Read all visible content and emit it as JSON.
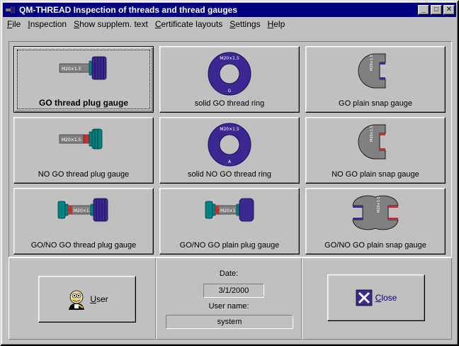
{
  "window": {
    "title": "QM-THREAD Inspection of threads and thread gauges",
    "controls": {
      "minimize": "_",
      "maximize": "□",
      "close": "✕"
    }
  },
  "menu": [
    {
      "key": "F",
      "rest": "ile"
    },
    {
      "key": "I",
      "rest": "nspection"
    },
    {
      "key": "S",
      "rest": "how supplem. text"
    },
    {
      "key": "C",
      "rest": "ertificate layouts"
    },
    {
      "key": "S",
      "rest": "ettings"
    },
    {
      "key": "H",
      "rest": "elp"
    }
  ],
  "gauges": [
    {
      "label": "GO thread plug gauge",
      "icon": "thread-plug-go-icon",
      "marking": "M20×1.5"
    },
    {
      "label": "solid GO thread ring",
      "icon": "thread-ring-go-icon",
      "marking": "M20×1.5",
      "letter": "G"
    },
    {
      "label": "GO plain snap gauge",
      "icon": "snap-gauge-go-icon",
      "marking": "M20×1.5"
    },
    {
      "label": "NO GO thread plug gauge",
      "icon": "thread-plug-nogo-icon",
      "marking": "M20×1.5"
    },
    {
      "label": "solid NO GO thread ring",
      "icon": "thread-ring-nogo-icon",
      "marking": "M20×1.5",
      "letter": "A"
    },
    {
      "label": "NO GO plain snap gauge",
      "icon": "snap-gauge-nogo-icon",
      "marking": "M20×1.5"
    },
    {
      "label": "GO/NO GO thread plug gauge",
      "icon": "thread-plug-gonogo-icon",
      "marking": "M20×1.5"
    },
    {
      "label": "GO/NO GO plain plug gauge",
      "icon": "plain-plug-gonogo-icon",
      "marking": "M20×1.5"
    },
    {
      "label": "GO/NO GO plain snap gauge",
      "icon": "snap-gauge-gonogo-icon",
      "marking": "M20×1.5"
    }
  ],
  "user_button": {
    "key": "U",
    "rest": "ser"
  },
  "close_button": {
    "key": "C",
    "rest": "lose"
  },
  "info": {
    "date_label": "Date:",
    "date_value": "3/1/2000",
    "user_label": "User name:",
    "user_value": "system"
  },
  "colors": {
    "titlebar": "#000080",
    "gauge_body": "#3c2890",
    "handle": "#808080",
    "teal": "#008080",
    "red": "#c03030"
  }
}
